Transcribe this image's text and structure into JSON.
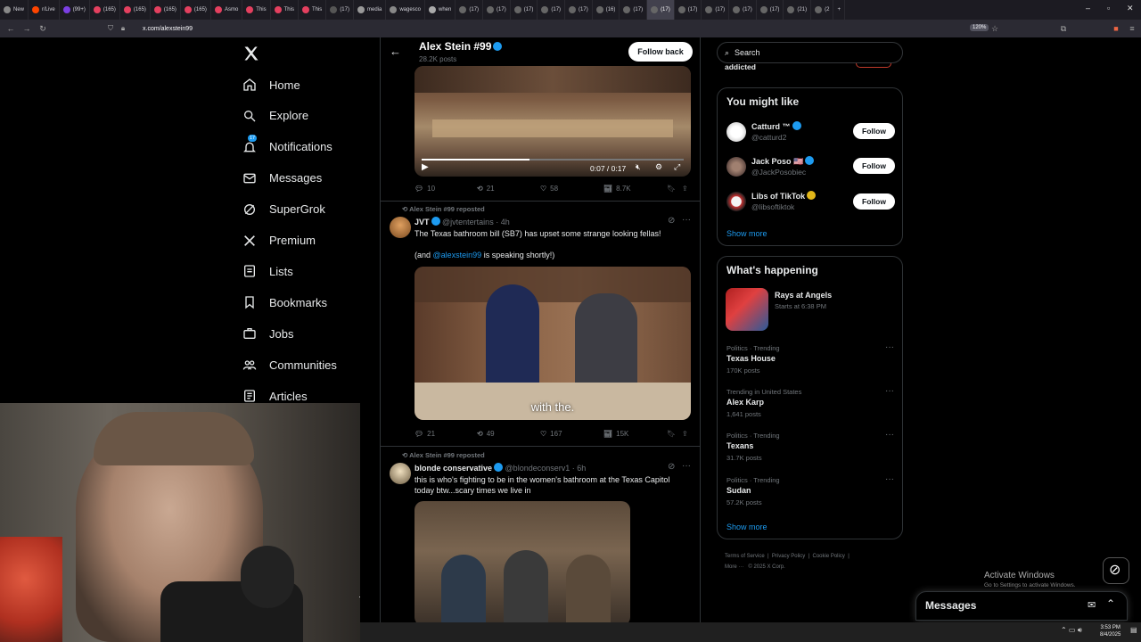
{
  "browser": {
    "tabs": [
      "New",
      "r/Live",
      "(99+)",
      "(165)",
      "(165)",
      "(165)",
      "(165)",
      "Asmo",
      "This",
      "This",
      "This",
      "(17)",
      "media",
      "wagesco",
      "when",
      "(17)",
      "(17)",
      "(17)",
      "(17)",
      "(17)",
      "(16)",
      "(17)",
      "(17)",
      "(17)",
      "(17)",
      "(17)",
      "(17)",
      "(21)",
      "(2"
    ],
    "active_tab_label": "(17)",
    "url": "x.com/alexstein99",
    "zoom": "120%"
  },
  "nav": {
    "items": [
      {
        "label": "Home",
        "icon": "home-icon"
      },
      {
        "label": "Explore",
        "icon": "search-icon"
      },
      {
        "label": "Notifications",
        "icon": "bell-icon",
        "badge": "17"
      },
      {
        "label": "Messages",
        "icon": "mail-icon"
      },
      {
        "label": "SuperGrok",
        "icon": "grok-icon"
      },
      {
        "label": "Premium",
        "icon": "x-logo-icon"
      },
      {
        "label": "Lists",
        "icon": "list-icon"
      },
      {
        "label": "Bookmarks",
        "icon": "bookmark-icon"
      },
      {
        "label": "Jobs",
        "icon": "briefcase-icon"
      },
      {
        "label": "Communities",
        "icon": "people-icon"
      },
      {
        "label": "Articles",
        "icon": "article-icon"
      }
    ]
  },
  "profile_header": {
    "name": "Alex Stein #99",
    "posts": "28.2K posts",
    "follow_back": "Follow back"
  },
  "tweets": [
    {
      "video_time": "0:07 / 0:17",
      "replies": "10",
      "reposts": "21",
      "likes": "58",
      "views": "8.7K"
    },
    {
      "reposted_by": "Alex Stein #99 reposted",
      "name": "JVT",
      "handle": "@jvtentertains",
      "time": "4h",
      "text_line1": "The Texas bathroom bill (SB7) has upset some strange looking fellas!",
      "text_line2_pre": "(and ",
      "text_line2_link": "@alexstein99",
      "text_line2_post": " is speaking shortly!)",
      "caption": "with the.",
      "replies": "21",
      "reposts": "49",
      "likes": "167",
      "views": "15K"
    },
    {
      "reposted_by": "Alex Stein #99 reposted",
      "name": "blonde conservative",
      "handle": "@blondeconserv1",
      "time": "6h",
      "text": "this is who's fighting to be in the women's bathroom at the Texas Capitol today btw...scary times we live in"
    }
  ],
  "right": {
    "search_placeholder": "Search",
    "truncated_item": "addicted",
    "you_might_like": {
      "title": "You might like",
      "users": [
        {
          "name": "Catturd ™",
          "handle": "@catturd2",
          "badge": "blue"
        },
        {
          "name": "Jack Poso 🇺🇸",
          "handle": "@JackPosobiec",
          "badge": "blue"
        },
        {
          "name": "Libs of TikTok",
          "handle": "@libsoftiktok",
          "badge": "gold"
        }
      ],
      "follow_label": "Follow",
      "show_more": "Show more"
    },
    "whats_happening": {
      "title": "What's happening",
      "event": {
        "name": "Rays at Angels",
        "time": "Starts at 6:38 PM"
      },
      "trends": [
        {
          "meta": "Politics · Trending",
          "name": "Texas House",
          "count": "170K posts"
        },
        {
          "meta": "Trending in United States",
          "name": "Alex Karp",
          "count": "1,641 posts"
        },
        {
          "meta": "Politics · Trending",
          "name": "Texans",
          "count": "31.7K posts"
        },
        {
          "meta": "Politics · Trending",
          "name": "Sudan",
          "count": "57.2K posts"
        }
      ],
      "show_more": "Show more"
    },
    "footer": {
      "terms": "Terms of Service",
      "privacy": "Privacy Policy",
      "cookie": "Cookie Policy",
      "more": "More ···",
      "copyright": "© 2025 X Corp."
    }
  },
  "windows": {
    "activate_title": "Activate Windows",
    "activate_sub": "Go to Settings to activate Windows.",
    "clock_time": "3:53 PM",
    "clock_date": "8/4/2025"
  },
  "messages_dock": {
    "title": "Messages"
  },
  "colors": {
    "accent": "#1d9bf0",
    "gold_badge": "#e2b719",
    "border": "#2f3336",
    "muted": "#71767b"
  }
}
